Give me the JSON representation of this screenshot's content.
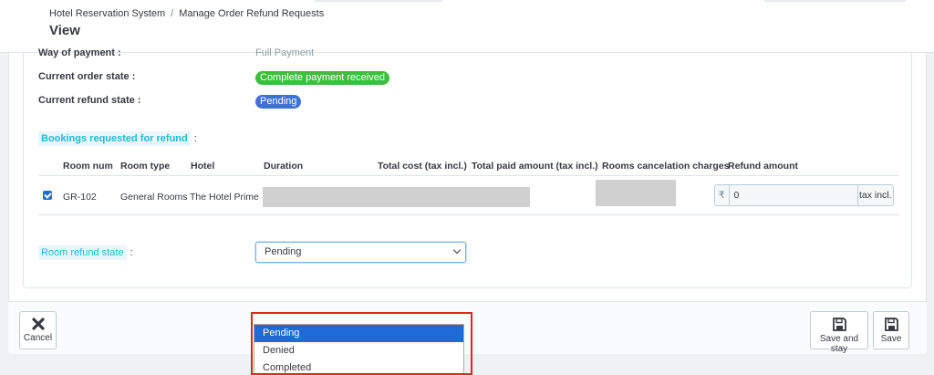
{
  "breadcrumb": {
    "root": "Hotel Reservation System",
    "separator": "/",
    "current": "Manage Order Refund Requests"
  },
  "page_title": "View",
  "order": {
    "way_of_payment_label": "Way of payment :",
    "way_of_payment_value": "Full Payment",
    "current_order_state_label": "Current order state :",
    "current_order_state_value": "Complete payment received",
    "current_refund_state_label": "Current refund state :",
    "current_refund_state_value": "Pending"
  },
  "bookings_section": {
    "title": "Bookings requested for refund",
    "colon": ":"
  },
  "table": {
    "headers": [
      "Room num",
      "Room type",
      "Hotel",
      "Duration",
      "Total cost (tax incl.)",
      "Total paid amount (tax incl.)",
      "Rooms cancelation charges",
      "Refund amount"
    ],
    "rows": [
      {
        "room_num": "GR-102",
        "room_type": "General Rooms",
        "hotel": "The Hotel Prime",
        "currency": "₹",
        "refund_amount": "0",
        "tax_suffix": "tax incl."
      }
    ]
  },
  "room_refund_state": {
    "label": "Room refund state",
    "colon": ":",
    "selected": "Pending",
    "options": [
      "Pending",
      "Denied",
      "Completed"
    ]
  },
  "buttons": {
    "cancel": "Cancel",
    "save_and_stay": "Save and stay",
    "save": "Save"
  },
  "colors": {
    "order_state_badge": "#3cbe3c",
    "refund_state_badge": "#3f70d6",
    "accent": "#25b9d7",
    "highlight_border": "#e1261c",
    "selected_option": "#1e6ad6"
  },
  "icons": {
    "cancel": "close-icon",
    "save_and_stay": "floppy-disk-icon",
    "save": "floppy-disk-icon",
    "checkbox": "checkbox-checked-icon",
    "select": "chevron-down-icon"
  }
}
